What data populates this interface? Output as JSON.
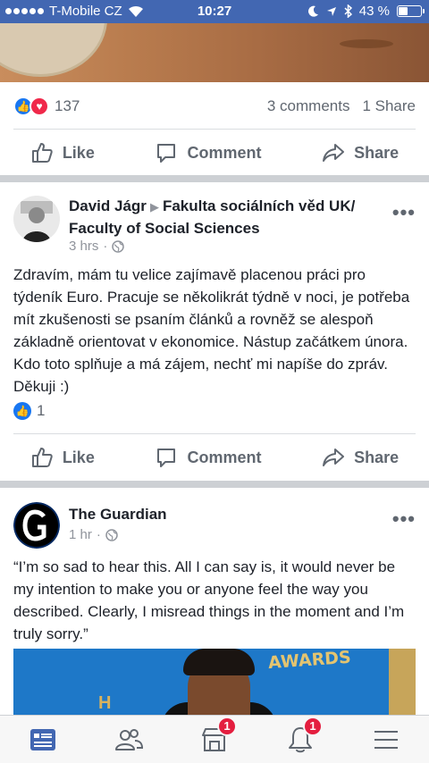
{
  "status_bar": {
    "carrier": "T-Mobile CZ",
    "time": "10:27",
    "battery_text": "43 %",
    "battery_level": 0.43
  },
  "post1": {
    "reaction_count": "137",
    "comments": "3 comments",
    "shares": "1 Share"
  },
  "actions": {
    "like": "Like",
    "comment": "Comment",
    "share": "Share"
  },
  "post2": {
    "author": "David Jágr",
    "group": "Fakulta sociálních věd UK/ Faculty of Social Sciences",
    "time": "3 hrs",
    "text": "Zdravím, mám tu velice zajímavě placenou práci pro týdeník Euro. Pracuje se několikrát týdně v noci, je potřeba mít zkušenosti se psaním článků a rovněž se alespoň základně orientovat v ekonomice. Nástup začátkem února. Kdo toto splňuje a má zájem, nechť mi napíše do zpráv. Děkuji :)",
    "like_count": "1"
  },
  "post3": {
    "author": "The Guardian",
    "time": "1 hr",
    "text": "“I’m so sad to hear this. All I can say is, it would never be my intention to make you or anyone feel the way you described. Clearly, I misread things in the moment and I’m truly sorry.”",
    "image_text": "AWARDS"
  },
  "bottom_nav": {
    "marketplace_badge": "1",
    "notifications_badge": "1"
  },
  "colors": {
    "brand": "#4267b2",
    "active_nav": "#4267b2",
    "badge": "#e41e3f"
  }
}
